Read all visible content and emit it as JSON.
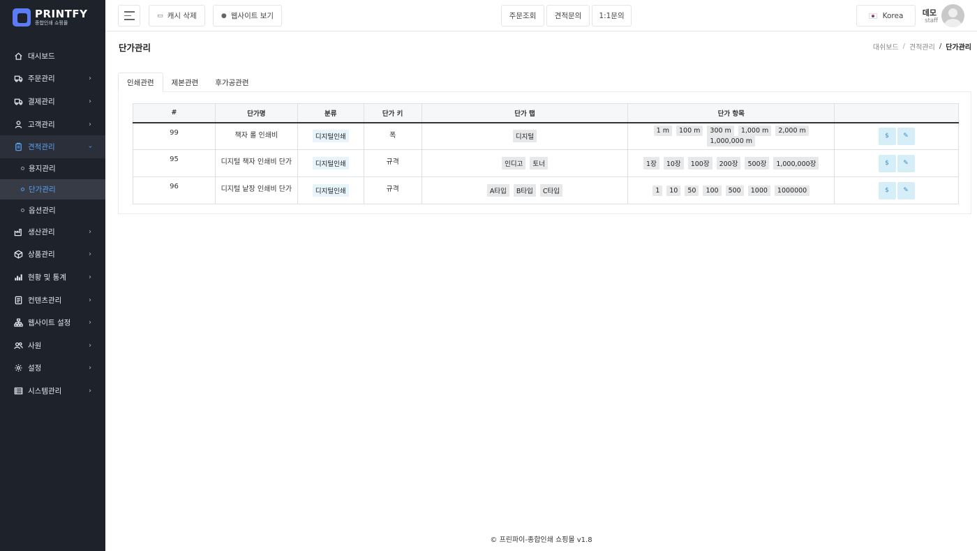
{
  "brand": {
    "title": "PRINTFY",
    "subtitle": "종합인쇄 쇼핑몰"
  },
  "sidebar": {
    "items": [
      {
        "label": "대시보드",
        "icon": "home-icon"
      },
      {
        "label": "주문관리",
        "icon": "truck-icon"
      },
      {
        "label": "결제관리",
        "icon": "truck-icon"
      },
      {
        "label": "고객관리",
        "icon": "user-icon"
      },
      {
        "label": "견적관리",
        "icon": "clipboard-icon"
      },
      {
        "label": "생산관리",
        "icon": "factory-icon"
      },
      {
        "label": "상품관리",
        "icon": "box-icon"
      },
      {
        "label": "현황 및 통계",
        "icon": "bar-chart-icon"
      },
      {
        "label": "컨텐츠관리",
        "icon": "document-icon"
      },
      {
        "label": "웹사이트 설정",
        "icon": "sitemap-icon"
      },
      {
        "label": "사원",
        "icon": "users-icon"
      },
      {
        "label": "설정",
        "icon": "gear-icon"
      },
      {
        "label": "시스템관리",
        "icon": "server-icon"
      }
    ],
    "subitems": [
      {
        "label": "용지관리"
      },
      {
        "label": "단가관리"
      },
      {
        "label": "옵션관리"
      }
    ],
    "active_item": "견적관리",
    "active_subitem": "단가관리"
  },
  "topbar": {
    "cache_label": "캐시 삭제",
    "website_label": "웹사이트 보기",
    "order_lookup": "주문조회",
    "quote_inquiry": "견적문의",
    "one_on_one": "1:1문의",
    "language": "Korea",
    "user_name": "데모",
    "user_role": "staff"
  },
  "page": {
    "title": "단가관리",
    "breadcrumb": [
      "대쉬보드",
      "견적관리",
      "단가관리"
    ]
  },
  "tabs": [
    "인쇄관련",
    "제본관련",
    "후가공관련"
  ],
  "table": {
    "headers": [
      "#",
      "단가명",
      "분류",
      "단가 키",
      "단가 탭",
      "단가 항목",
      ""
    ],
    "rows": [
      {
        "id": "99",
        "name": "책자 롤 인쇄비",
        "category": "디지털인쇄",
        "key": "폭",
        "tabs": [
          "디지털"
        ],
        "items": [
          "1 m",
          "100 m",
          "300 m",
          "1,000 m",
          "2,000 m",
          "1,000,000 m"
        ]
      },
      {
        "id": "95",
        "name": "디지털 책자 인쇄비 단가",
        "category": "디지털인쇄",
        "key": "규격",
        "tabs": [
          "인디고",
          "토너"
        ],
        "items": [
          "1장",
          "10장",
          "100장",
          "200장",
          "500장",
          "1,000,000장"
        ]
      },
      {
        "id": "96",
        "name": "디지털 낱장 인쇄비 단가",
        "category": "디지털인쇄",
        "key": "규격",
        "tabs": [
          "A타입",
          "B타입",
          "C타입"
        ],
        "items": [
          "1",
          "10",
          "50",
          "100",
          "500",
          "1000",
          "1000000"
        ]
      }
    ],
    "action_price": "$",
    "action_edit": "✎"
  },
  "footer": "© 프린파이-종합인쇄 쇼핑몰 v1.8"
}
